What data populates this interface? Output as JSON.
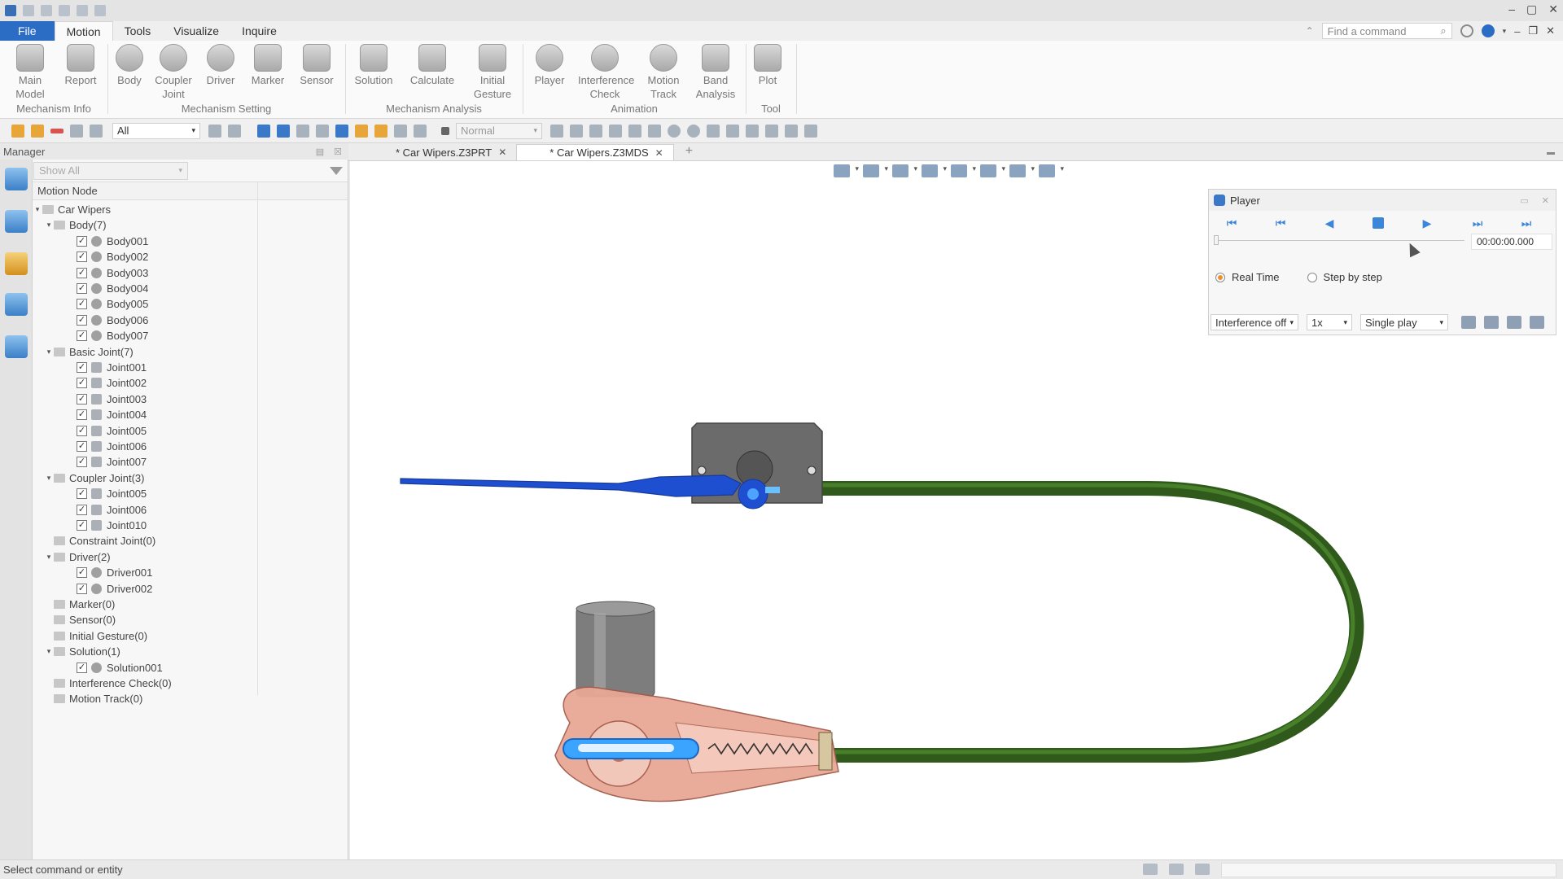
{
  "ribbon_tabs": [
    "File",
    "Motion",
    "Tools",
    "Visualize",
    "Inquire"
  ],
  "command_search": {
    "placeholder": "Find a command"
  },
  "ribbon": {
    "buttons": [
      {
        "label": "Main Model",
        "icon": "model-icon"
      },
      {
        "label": "Report",
        "icon": "report-icon"
      },
      {
        "label": "Body",
        "icon": "body-icon"
      },
      {
        "label": "Coupler Joint",
        "icon": "coupler-joint-icon"
      },
      {
        "label": "Driver",
        "icon": "driver-icon"
      },
      {
        "label": "Marker",
        "icon": "marker-icon"
      },
      {
        "label": "Sensor",
        "icon": "sensor-icon"
      },
      {
        "label": "Solution",
        "icon": "solution-icon"
      },
      {
        "label": "Calculate",
        "icon": "calculate-icon"
      },
      {
        "label": "Initial Gesture",
        "icon": "initial-gesture-icon"
      },
      {
        "label": "Player",
        "icon": "player-icon"
      },
      {
        "label": "Interference Check",
        "icon": "interference-check-icon"
      },
      {
        "label": "Motion Track",
        "icon": "motion-track-icon"
      },
      {
        "label": "Band Analysis",
        "icon": "band-analysis-icon"
      },
      {
        "label": "Plot",
        "icon": "plot-icon"
      }
    ],
    "groups": [
      "Mechanism Info",
      "Mechanism Setting",
      "Mechanism Analysis",
      "Animation",
      "Tool"
    ]
  },
  "toolbar": {
    "filter_value": "All",
    "mode_value": "Normal"
  },
  "manager": {
    "title": "Manager",
    "filter_value": "Show All",
    "column_header": "Motion Node",
    "tree": [
      {
        "label": "Car Wipers",
        "level": 0,
        "expander": "▾",
        "checkbox": false,
        "kind": "root"
      },
      {
        "label": "Body(7)",
        "level": 1,
        "expander": "▾",
        "checkbox": false,
        "kind": "folder"
      },
      {
        "label": "Body001",
        "level": 2,
        "expander": "",
        "checkbox": true,
        "kind": "body"
      },
      {
        "label": "Body002",
        "level": 2,
        "expander": "",
        "checkbox": true,
        "kind": "body"
      },
      {
        "label": "Body003",
        "level": 2,
        "expander": "",
        "checkbox": true,
        "kind": "body"
      },
      {
        "label": "Body004",
        "level": 2,
        "expander": "",
        "checkbox": true,
        "kind": "body"
      },
      {
        "label": "Body005",
        "level": 2,
        "expander": "",
        "checkbox": true,
        "kind": "body"
      },
      {
        "label": "Body006",
        "level": 2,
        "expander": "",
        "checkbox": true,
        "kind": "body"
      },
      {
        "label": "Body007",
        "level": 2,
        "expander": "",
        "checkbox": true,
        "kind": "body"
      },
      {
        "label": "Basic Joint(7)",
        "level": 1,
        "expander": "▾",
        "checkbox": false,
        "kind": "folder"
      },
      {
        "label": "Joint001",
        "level": 2,
        "expander": "",
        "checkbox": true,
        "kind": "joint"
      },
      {
        "label": "Joint002",
        "level": 2,
        "expander": "",
        "checkbox": true,
        "kind": "joint"
      },
      {
        "label": "Joint003",
        "level": 2,
        "expander": "",
        "checkbox": true,
        "kind": "joint"
      },
      {
        "label": "Joint004",
        "level": 2,
        "expander": "",
        "checkbox": true,
        "kind": "joint"
      },
      {
        "label": "Joint005",
        "level": 2,
        "expander": "",
        "checkbox": true,
        "kind": "joint"
      },
      {
        "label": "Joint006",
        "level": 2,
        "expander": "",
        "checkbox": true,
        "kind": "joint"
      },
      {
        "label": "Joint007",
        "level": 2,
        "expander": "",
        "checkbox": true,
        "kind": "joint"
      },
      {
        "label": "Coupler Joint(3)",
        "level": 1,
        "expander": "▾",
        "checkbox": false,
        "kind": "folder"
      },
      {
        "label": "Joint005",
        "level": 2,
        "expander": "",
        "checkbox": true,
        "kind": "joint"
      },
      {
        "label": "Joint006",
        "level": 2,
        "expander": "",
        "checkbox": true,
        "kind": "joint"
      },
      {
        "label": "Joint010",
        "level": 2,
        "expander": "",
        "checkbox": true,
        "kind": "joint"
      },
      {
        "label": "Constraint Joint(0)",
        "level": 1,
        "expander": "",
        "checkbox": false,
        "kind": "folder"
      },
      {
        "label": "Driver(2)",
        "level": 1,
        "expander": "▾",
        "checkbox": false,
        "kind": "folder"
      },
      {
        "label": "Driver001",
        "level": 2,
        "expander": "",
        "checkbox": true,
        "kind": "driver"
      },
      {
        "label": "Driver002",
        "level": 2,
        "expander": "",
        "checkbox": true,
        "kind": "driver"
      },
      {
        "label": "Marker(0)",
        "level": 1,
        "expander": "",
        "checkbox": false,
        "kind": "folder"
      },
      {
        "label": "Sensor(0)",
        "level": 1,
        "expander": "",
        "checkbox": false,
        "kind": "folder"
      },
      {
        "label": "Initial Gesture(0)",
        "level": 1,
        "expander": "",
        "checkbox": false,
        "kind": "folder"
      },
      {
        "label": "Solution(1)",
        "level": 1,
        "expander": "▾",
        "checkbox": false,
        "kind": "folder"
      },
      {
        "label": "Solution001",
        "level": 2,
        "expander": "",
        "checkbox": true,
        "kind": "solution"
      },
      {
        "label": "Interference Check(0)",
        "level": 1,
        "expander": "",
        "checkbox": false,
        "kind": "folder"
      },
      {
        "label": "Motion Track(0)",
        "level": 1,
        "expander": "",
        "checkbox": false,
        "kind": "folder"
      }
    ]
  },
  "document_tabs": [
    {
      "label": "* Car Wipers.Z3PRT",
      "active": false
    },
    {
      "label": "* Car Wipers.Z3MDS",
      "active": true
    }
  ],
  "player": {
    "title": "Player",
    "time": "00:00:00.000",
    "progress": 0,
    "radio_real_time": "Real Time",
    "radio_step": "Step by step",
    "interference_value": "Interference off",
    "speed_value": "1x",
    "play_mode_value": "Single play"
  },
  "status": {
    "text": "Select command or entity"
  },
  "colors": {
    "accent": "#2b6cc4",
    "wiper_blue": "#1f4fd1",
    "cable_green": "#3d6a24",
    "housing_pink": "#e8a896",
    "motor_gray": "#8a8a8a"
  }
}
